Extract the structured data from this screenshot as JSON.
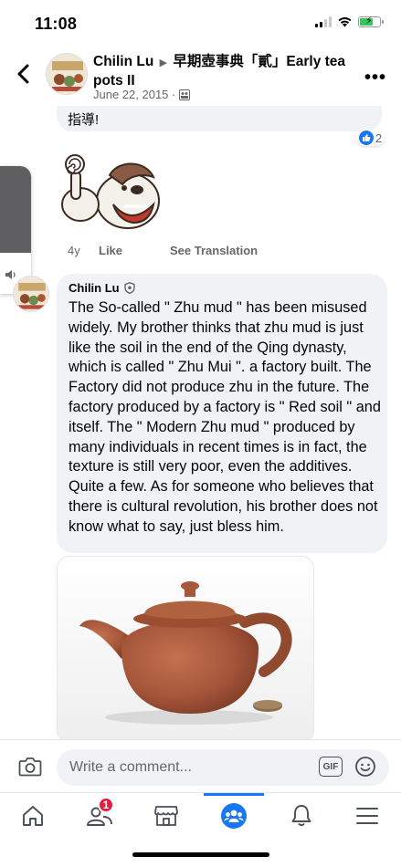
{
  "status_bar": {
    "time": "11:08",
    "battery_level": 0.7
  },
  "header": {
    "author": "Chilin Lu",
    "group": "早期壺事典「貳」Early tea pots II",
    "date": "June 22, 2015 ·",
    "privacy_icon": "group-privacy-icon"
  },
  "prev_comment": {
    "text_tail": "指導!",
    "reaction_count": "2",
    "actions": {
      "time": "4y",
      "like": "Like",
      "translate": "See Translation"
    }
  },
  "comment": {
    "author": "Chilin Lu",
    "author_badge": "shield-icon",
    "text": "The So-called \" Zhu mud \" has been misused widely. My brother thinks that zhu mud is just like the soil in the end of the Qing dynasty, which is called \" Zhu Mui \". a factory built. The Factory did not produce zhu in the future. The factory produced by a factory is \" Red soil \" and itself. The \" Modern Zhu mud \" produced by many individuals in recent times is in fact, the texture is still very poor, even the additives. Quite a few. As for someone who believes that there is cultural revolution, his brother does not know what to say, just bless him."
  },
  "composer": {
    "placeholder": "Write a comment...",
    "gif_label": "GIF"
  },
  "tabbar": {
    "items": [
      "home",
      "friends",
      "marketplace",
      "groups",
      "notifications",
      "menu"
    ],
    "active": "groups",
    "friends_badge": "1"
  },
  "colors": {
    "accent": "#1877f2",
    "bubble": "#f0f2f5",
    "badge": "#e41e3f",
    "secondary_text": "#65676b"
  }
}
